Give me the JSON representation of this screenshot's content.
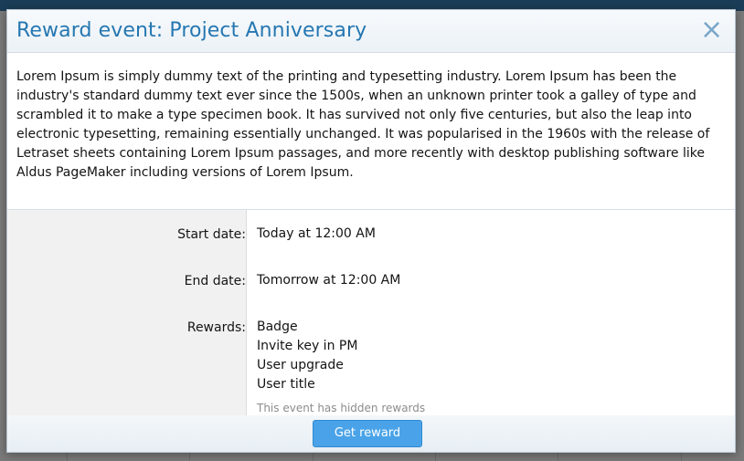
{
  "dialog": {
    "title": "Reward event: Project Anniversary",
    "close_glyph": "×",
    "description": "Lorem Ipsum is simply dummy text of the printing and typesetting industry. Lorem Ipsum has been the industry's standard dummy text ever since the 1500s, when an unknown printer took a galley of type and scrambled it to make a type specimen book. It has survived not only five centuries, but also the leap into electronic typesetting, remaining essentially unchanged. It was popularised in the 1960s with the release of Letraset sheets containing Lorem Ipsum passages, and more recently with desktop publishing software like Aldus PageMaker including versions of Lorem Ipsum.",
    "start_date": {
      "label": "Start date:",
      "value": "Today at 12:00 AM"
    },
    "end_date": {
      "label": "End date:",
      "value": "Tomorrow at 12:00 AM"
    },
    "rewards": {
      "label": "Rewards:",
      "items": [
        "Badge",
        "Invite key in PM",
        "User upgrade",
        "User title"
      ],
      "hidden_note": "This event has hidden rewards"
    },
    "get_reward_label": "Get reward"
  },
  "colors": {
    "title": "#2577b1",
    "button": "#4aa3e8",
    "top_bar": "#1b3d57"
  }
}
